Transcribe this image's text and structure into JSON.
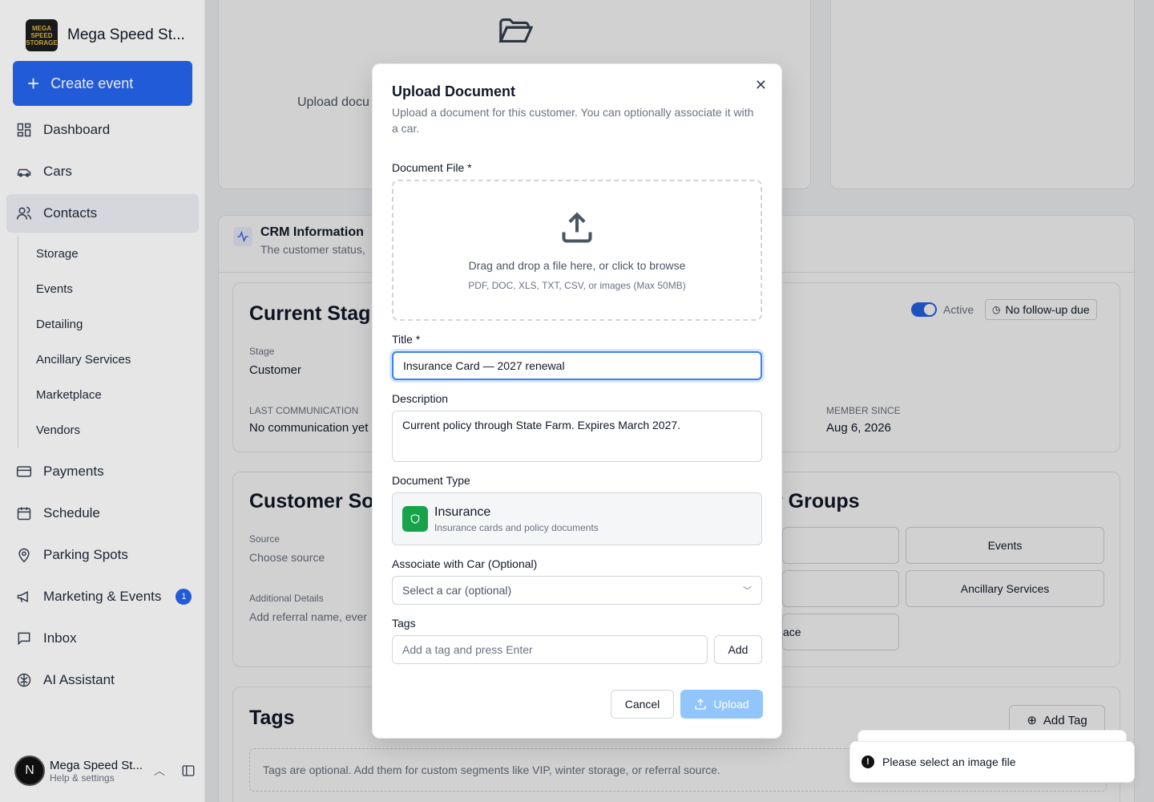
{
  "sidebar": {
    "brand_name": "Mega Speed St...",
    "logo_text": "MEGA SPEED STORAGE",
    "create_label": "Create event",
    "items": [
      {
        "label": "Dashboard",
        "icon": "dashboard-icon"
      },
      {
        "label": "Cars",
        "icon": "car-icon"
      },
      {
        "label": "Contacts",
        "icon": "users-icon"
      },
      {
        "label": "Payments",
        "icon": "credit-card-icon"
      },
      {
        "label": "Schedule",
        "icon": "calendar-icon"
      },
      {
        "label": "Parking Spots",
        "icon": "map-pin-icon"
      },
      {
        "label": "Marketing & Events",
        "icon": "megaphone-icon",
        "badge": "1"
      },
      {
        "label": "Inbox",
        "icon": "message-icon"
      },
      {
        "label": "AI Assistant",
        "icon": "brain-icon"
      }
    ],
    "subitems": [
      "Storage",
      "Events",
      "Detailing",
      "Ancillary Services",
      "Marketplace",
      "Vendors"
    ],
    "user": {
      "initial": "N",
      "name": "Mega Speed St...",
      "sub": "Help & settings"
    }
  },
  "background": {
    "upload_text": "Upload docu",
    "crm_title": "CRM Information",
    "crm_sub": "The customer status,",
    "current_stage_title": "Current Stag",
    "stage_label": "Stage",
    "stage_value": "Customer",
    "last_comm_label": "LAST COMMUNICATION",
    "last_comm_value": "No communication yet",
    "member_since_label": "MEMBER SINCE",
    "member_since_value": "Aug 6, 2026",
    "active_label": "Active",
    "followup_label": "No follow-up due",
    "source_title": "Customer So",
    "source_label": "Source",
    "source_value": "Choose source",
    "additional_label": "Additional Details",
    "additional_value": "Add referral name, ever",
    "groups_title": "r Groups",
    "group_events": "Events",
    "group_ancillary": "Ancillary Services",
    "group_marketplace": "ace",
    "tags_title": "Tags",
    "add_tag": "Add Tag",
    "tags_help": "Tags are optional. Add them for custom segments like VIP, winter storage, or referral source."
  },
  "modal": {
    "title": "Upload Document",
    "description": "Upload a document for this customer. You can optionally associate it with a car.",
    "file_label": "Document File *",
    "drop_main": "Drag and drop a file here, or click to browse",
    "drop_sub": "PDF, DOC, XLS, TXT, CSV, or images (Max 50MB)",
    "title_label": "Title *",
    "title_value": "Insurance Card — 2027 renewal",
    "desc_label": "Description",
    "desc_value": "Current policy through State Farm. Expires March 2027.",
    "type_label": "Document Type",
    "type_title": "Insurance",
    "type_sub": "Insurance cards and policy documents",
    "car_label": "Associate with Car (Optional)",
    "car_placeholder": "Select a car (optional)",
    "tags_label": "Tags",
    "tags_placeholder": "Add a tag and press Enter",
    "add_label": "Add",
    "cancel_label": "Cancel",
    "upload_label": "Upload"
  },
  "toast": {
    "message": "Please select an image file"
  },
  "colors": {
    "accent": "#2563eb",
    "insurance": "#16a34a",
    "upload_disabled": "#93c5fd"
  }
}
